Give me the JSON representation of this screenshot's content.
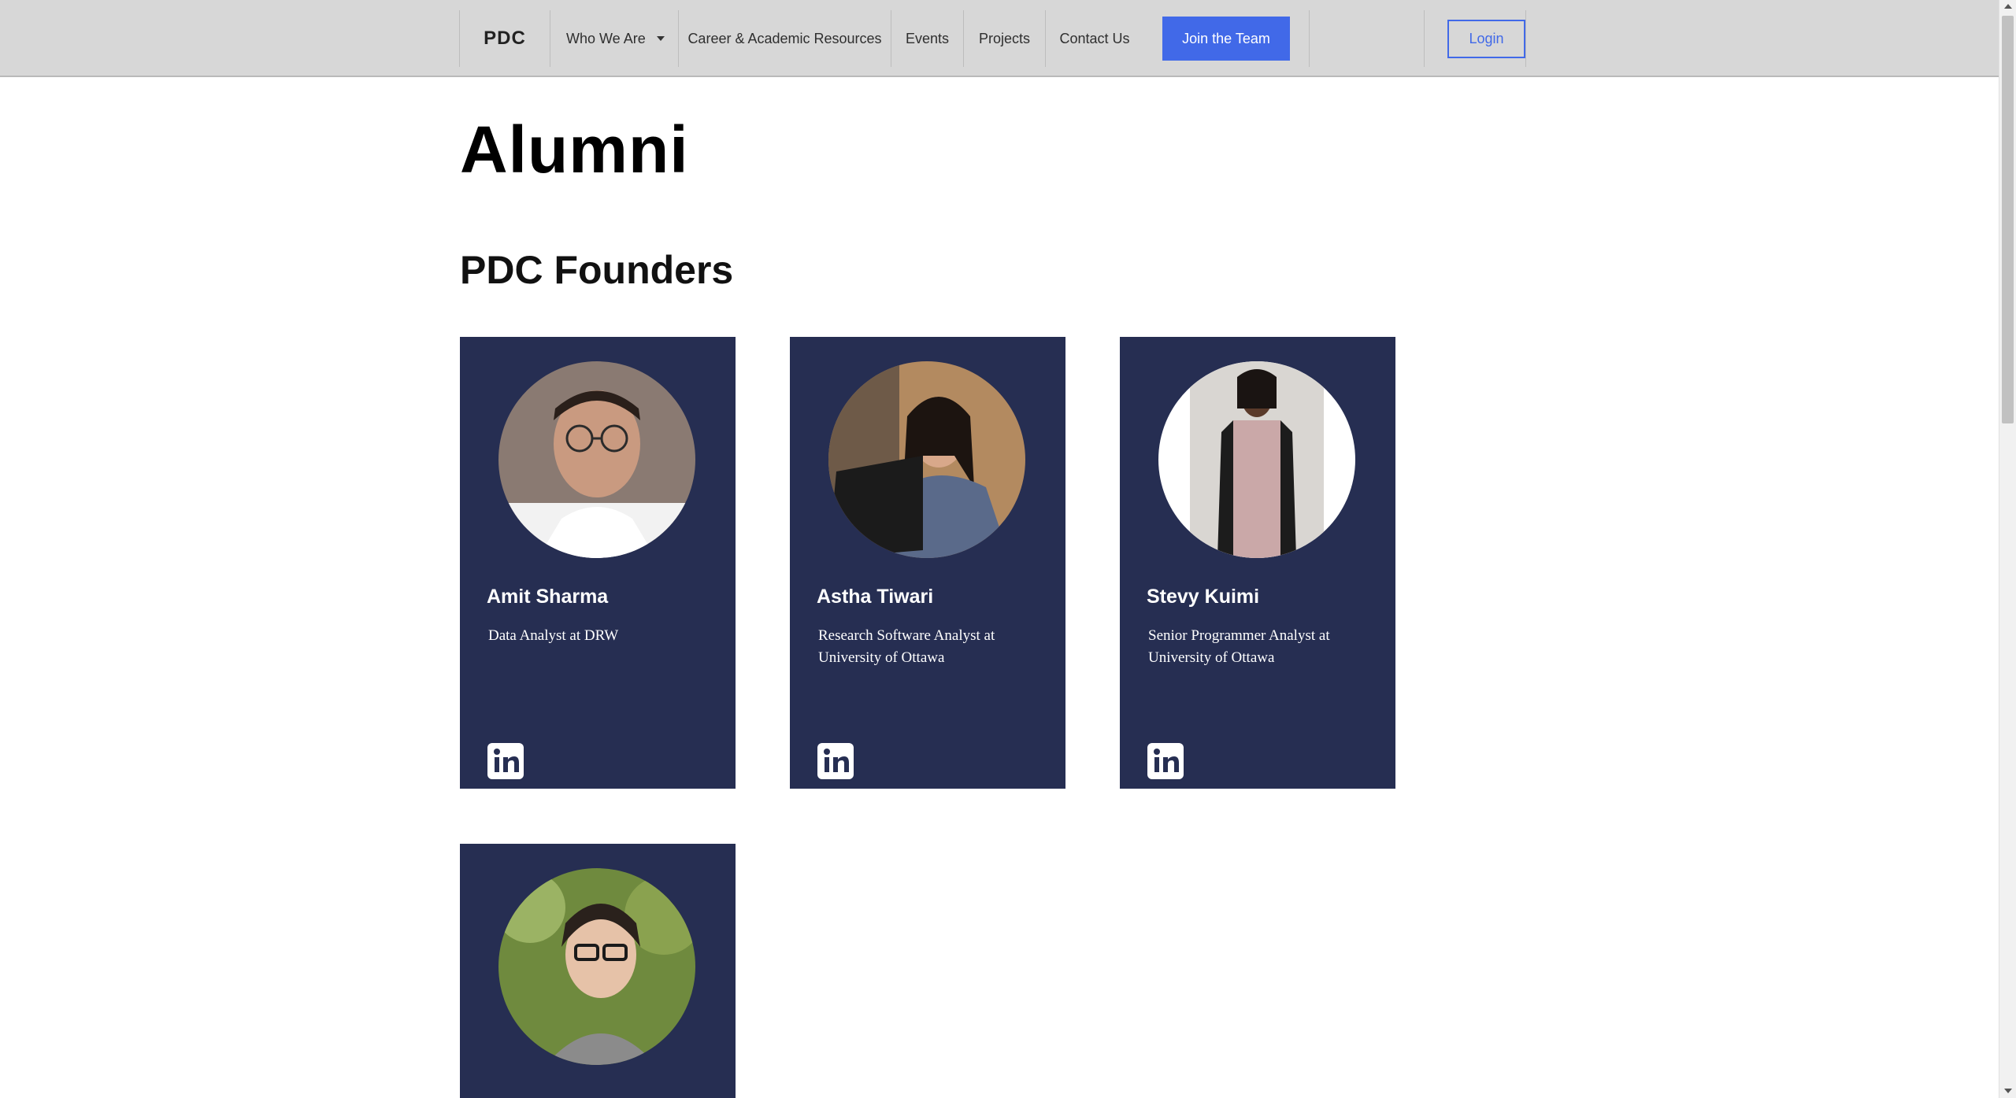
{
  "nav": {
    "brand": "PDC",
    "who_we_are": "Who We Are",
    "career": "Career & Academic Resources",
    "events": "Events",
    "projects": "Projects",
    "contact": "Contact Us",
    "join": "Join the Team",
    "login": "Login"
  },
  "page": {
    "title": "Alumni",
    "section_title": "PDC Founders"
  },
  "members": [
    {
      "name": "Amit Sharma",
      "role": "Data Analyst at DRW"
    },
    {
      "name": "Astha Tiwari",
      "role": "Research Software Analyst at University of Ottawa"
    },
    {
      "name": "Stevy Kuimi",
      "role": "Senior Programmer Analyst at University of Ottawa"
    },
    {
      "name": "",
      "role": ""
    }
  ],
  "icons": {
    "dropdown": "chevron-down-icon",
    "linkedin": "linkedin-icon"
  },
  "colors": {
    "accent": "#4169e8",
    "card_bg": "#262e52",
    "nav_bg": "#d7d7d7"
  }
}
